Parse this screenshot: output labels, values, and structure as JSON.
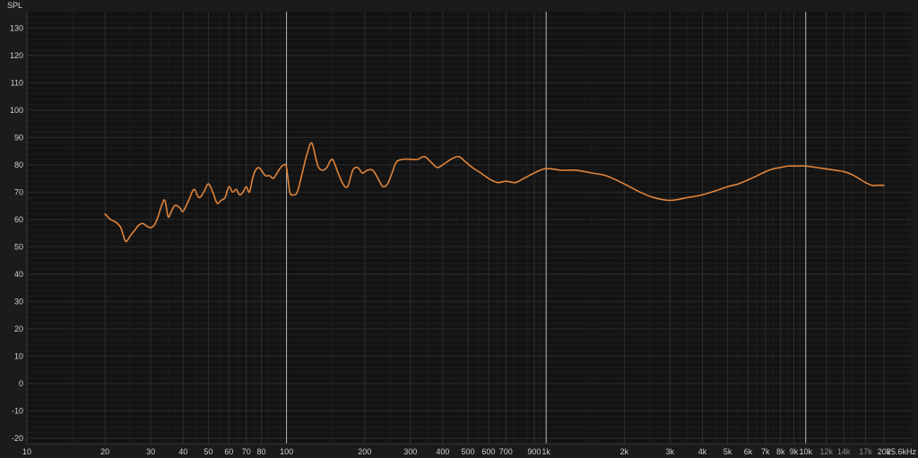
{
  "chart_data": {
    "type": "line",
    "ylabel": "SPL",
    "x_scale": "log",
    "xlim": [
      10,
      25600
    ],
    "ylim": [
      -22,
      136
    ],
    "grid": true,
    "line_color": "#e0843a",
    "y_ticks": [
      130,
      120,
      110,
      100,
      90,
      80,
      70,
      60,
      50,
      40,
      30,
      20,
      10,
      0,
      -10,
      -20
    ],
    "x_ticks": [
      {
        "value": 10,
        "label": "10"
      },
      {
        "value": 20,
        "label": "20"
      },
      {
        "value": 30,
        "label": "30"
      },
      {
        "value": 40,
        "label": "40"
      },
      {
        "value": 50,
        "label": "50"
      },
      {
        "value": 60,
        "label": "60"
      },
      {
        "value": 70,
        "label": "70"
      },
      {
        "value": 80,
        "label": "80"
      },
      {
        "value": 100,
        "label": "100"
      },
      {
        "value": 200,
        "label": "200"
      },
      {
        "value": 300,
        "label": "300"
      },
      {
        "value": 400,
        "label": "400"
      },
      {
        "value": 500,
        "label": "500"
      },
      {
        "value": 600,
        "label": "600"
      },
      {
        "value": 700,
        "label": "700"
      },
      {
        "value": 900,
        "label": "900"
      },
      {
        "value": 1000,
        "label": "1k"
      },
      {
        "value": 2000,
        "label": "2k"
      },
      {
        "value": 3000,
        "label": "3k"
      },
      {
        "value": 4000,
        "label": "4k"
      },
      {
        "value": 5000,
        "label": "5k"
      },
      {
        "value": 6000,
        "label": "6k"
      },
      {
        "value": 7000,
        "label": "7k"
      },
      {
        "value": 8000,
        "label": "8k"
      },
      {
        "value": 9000,
        "label": "9k"
      },
      {
        "value": 10000,
        "label": "10k"
      },
      {
        "value": 12000,
        "label": "12k",
        "dim": true
      },
      {
        "value": 14000,
        "label": "14k",
        "dim": true
      },
      {
        "value": 17000,
        "label": "17k",
        "dim": true
      },
      {
        "value": 20000,
        "label": "20k"
      },
      {
        "value": 25600,
        "label": "25.6kHz"
      }
    ],
    "series": [
      {
        "x": [
          20,
          21,
          22,
          23,
          24,
          25,
          26,
          27,
          28,
          29,
          30,
          31,
          32,
          33,
          34,
          35,
          36,
          37,
          38,
          39,
          40,
          42,
          44,
          46,
          48,
          50,
          52,
          54,
          56,
          58,
          60,
          62,
          64,
          66,
          68,
          70,
          72,
          74,
          76,
          78,
          80,
          83,
          86,
          89,
          92,
          95,
          98,
          100,
          103,
          106,
          110,
          115,
          120,
          125,
          130,
          133,
          138,
          143,
          150,
          158,
          165,
          172,
          180,
          188,
          196,
          205,
          215,
          225,
          235,
          245,
          255,
          265,
          280,
          300,
          320,
          340,
          360,
          380,
          400,
          430,
          460,
          490,
          520,
          560,
          600,
          650,
          700,
          760,
          820,
          900,
          980,
          1050,
          1150,
          1300,
          1500,
          1700,
          2000,
          2300,
          2600,
          3000,
          3500,
          4000,
          4500,
          5000,
          5500,
          6000,
          6500,
          7000,
          7500,
          8000,
          8500,
          9000,
          10000,
          11000,
          12000,
          13000,
          14000,
          15000,
          16000,
          17000,
          18000,
          19000,
          20000
        ],
        "y": [
          62,
          60,
          59,
          57,
          52,
          54,
          56,
          58,
          58.5,
          57.5,
          57,
          58,
          61,
          65,
          67,
          61,
          63,
          65,
          65,
          64,
          63,
          67,
          71,
          68,
          70,
          73,
          70,
          66,
          67,
          68,
          72,
          70,
          71,
          69,
          70,
          72,
          70,
          75,
          78,
          79,
          78,
          76,
          76,
          75,
          77,
          79,
          80,
          79,
          70,
          69,
          70,
          77,
          84,
          88,
          82,
          79,
          78,
          79,
          82,
          77,
          73,
          72,
          78,
          79,
          77,
          78,
          78,
          75,
          72,
          73,
          77,
          81,
          82,
          82,
          82,
          83,
          81,
          79,
          80,
          82,
          83,
          81,
          79,
          77,
          75,
          73.5,
          74,
          73.5,
          75,
          77,
          78.5,
          78.5,
          78,
          78,
          77,
          76,
          73,
          70,
          68,
          67,
          68,
          69,
          70.5,
          72,
          73,
          74.5,
          76,
          77.5,
          78.5,
          79,
          79.5,
          79.5,
          79.5,
          79,
          78.5,
          78,
          77.5,
          76.5,
          75,
          73.5,
          72.5,
          72.5,
          72.5
        ]
      }
    ]
  }
}
